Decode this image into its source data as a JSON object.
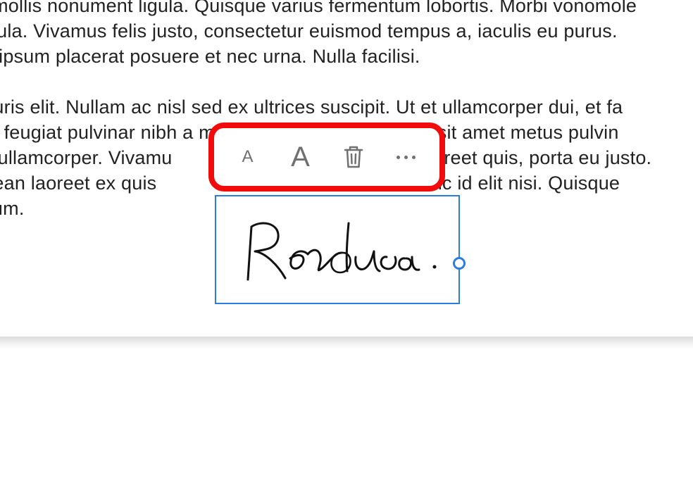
{
  "paragraphs": {
    "p1_line1": "x, mollis nonument ligula. Quisque varius fermentum lobortis. Morbi vonomole",
    "p1_line2": "hicula. Vivamus felis justo, consectetur euismod tempus a, iaculis eu purus.",
    "p1_line3": "eu ipsum placerat posuere et nec urna. Nulla facilisi.",
    "p2_line1": "nauris elit. Nullam ac nisl sed ex ultrices suscipit. Ut et ullamcorper dui, et fa",
    "p2_line2": "am feugiat pulvinar nibh a maximus. Nunc sagittis nisl sit amet metus pulvin",
    "p2_line3_left": "ps ullamcorper. Vivamu",
    "p2_line3_right": "aoreet quis, porta eu justo.",
    "p2_line4_left": "enean laoreet ex quis ",
    "p2_line4_right": " Nunc id elit nisi. Quisque",
    "p2_line5": "psum."
  },
  "toolbar": {
    "small_a": "A",
    "large_a": "A"
  },
  "signature": {
    "text": "Rendua ."
  },
  "colors": {
    "highlight_red": "#f10b0b",
    "selection_blue": "#2b7de1",
    "icon_grey": "#707070"
  }
}
